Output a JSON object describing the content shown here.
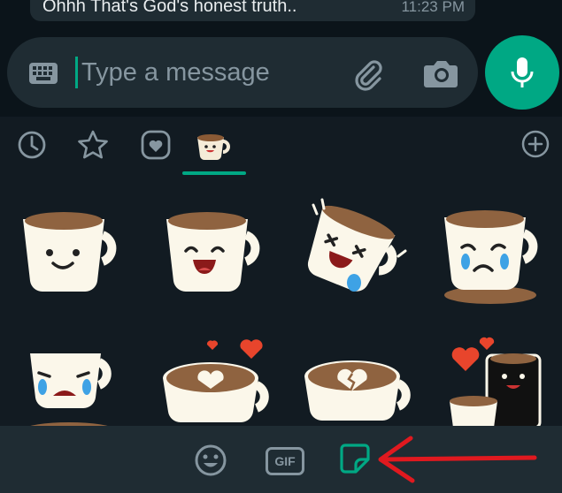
{
  "chat": {
    "last_message": "Ohhh That's God's honest truth..",
    "last_time": "11:23 PM"
  },
  "compose": {
    "placeholder": "Type a message",
    "icons": [
      "keyboard-icon",
      "paperclip-icon",
      "camera-icon",
      "mic-icon"
    ],
    "accent": "#00a884"
  },
  "sticker_tabs": [
    "recent-icon",
    "favorites-star-icon",
    "heart-icon",
    "coffee-pack-icon",
    "add-icon"
  ],
  "active_tab": "coffee-pack-icon",
  "stickers": [
    "coffee-smile",
    "coffee-laugh",
    "coffee-tipsy-laugh",
    "coffee-sad-cry",
    "coffee-crying",
    "coffee-latte-heart",
    "coffee-broken-heart",
    "coffee-pair-love"
  ],
  "bottom_bar": {
    "gif_label": "GIF",
    "tabs": [
      "emoji-icon",
      "gif-icon",
      "sticker-icon"
    ],
    "active": "sticker-icon"
  },
  "annotation_color": "#e0191f"
}
